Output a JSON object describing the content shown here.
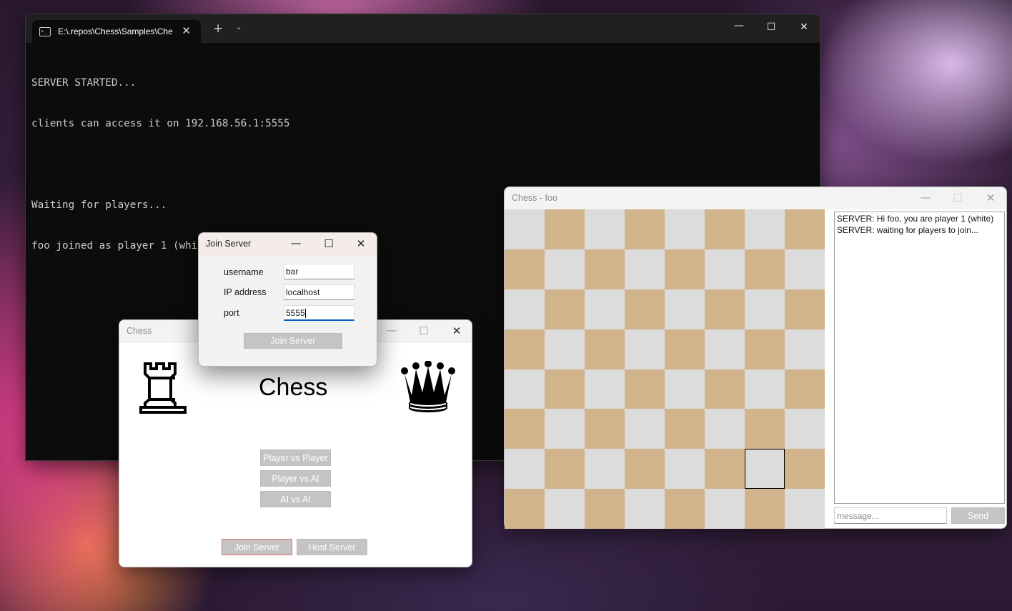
{
  "terminal": {
    "tab_title": "E:\\.repos\\Chess\\Samples\\Che",
    "tab_icon": "terminal-icon",
    "new_tab": "+",
    "dropdown": "chevron-down-icon",
    "lines": [
      "SERVER STARTED...",
      "clients can access it on 192.168.56.1:5555",
      "",
      "Waiting for players...",
      "foo joined as player 1 (white)"
    ]
  },
  "chess_main": {
    "title": "Chess",
    "heading": "Chess",
    "rook_icon": "rook-icon",
    "queen_icon": "queen-icon",
    "buttons": {
      "pvp": "Player vs Player",
      "pva": "Player vs AI",
      "ava": "AI vs AI",
      "join": "Join Server",
      "host": "Host Server"
    }
  },
  "join_dialog": {
    "title": "Join Server",
    "fields": {
      "username_label": "username",
      "username_value": "bar",
      "ip_label": "IP address",
      "ip_value": "localhost",
      "port_label": "port",
      "port_value": "5555"
    },
    "submit": "Join Server"
  },
  "chess_foo": {
    "title": "Chess - foo",
    "board": {
      "light": "#dcdcdc",
      "dark": "#d2b48c",
      "selected": "g2"
    },
    "chat": [
      "SERVER: Hi foo, you are player 1 (white)",
      "SERVER: waiting for players to join..."
    ],
    "message_placeholder": "message...",
    "send": "Send"
  }
}
